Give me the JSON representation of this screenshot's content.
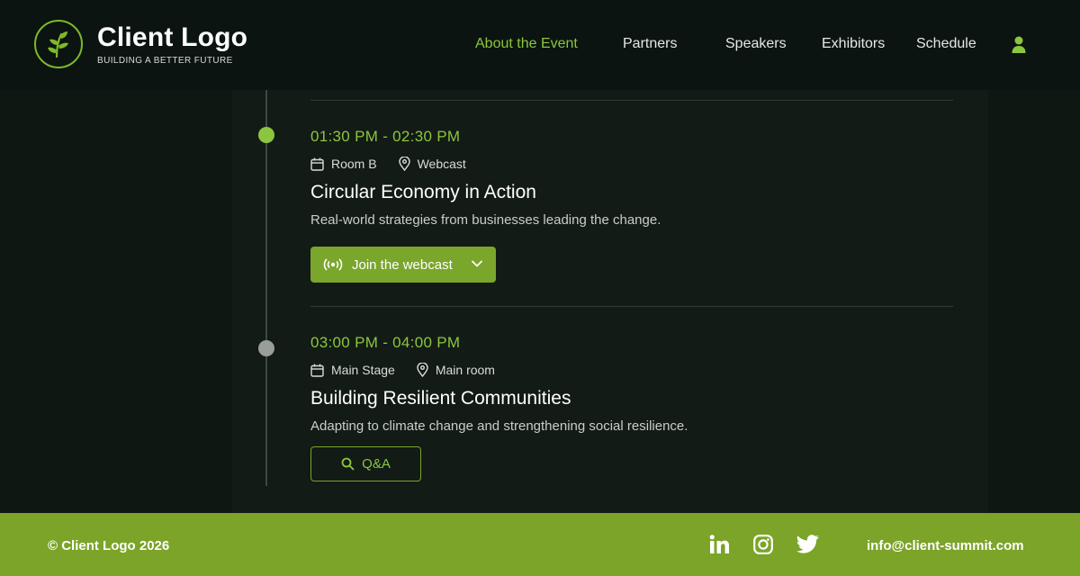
{
  "brand": {
    "title": "Client Logo",
    "tagline": "BUILDING A BETTER FUTURE",
    "accent": "#8cc63f"
  },
  "nav": {
    "items": [
      {
        "label": "About the Event",
        "active": true
      },
      {
        "label": "Partners",
        "active": false
      },
      {
        "label": "Speakers",
        "active": false
      },
      {
        "label": "Exhibitors",
        "active": false
      },
      {
        "label": "Schedule",
        "active": false
      }
    ],
    "user_icon": "user-icon"
  },
  "sessions": [
    {
      "time": "01:30 PM - 02:30 PM",
      "room": "Room B",
      "location": "Webcast",
      "title": "Circular Economy in Action",
      "description": "Real-world strategies from businesses leading the change.",
      "status": "active",
      "action": {
        "label": "Join the webcast",
        "icon": "broadcast-icon",
        "style": "filled"
      }
    },
    {
      "time": "03:00 PM - 04:00 PM",
      "room": "Main Stage",
      "location": "Main room",
      "title": "Building Resilient Communities",
      "description": "Adapting to climate change and strengthening social resilience.",
      "status": "upcoming",
      "action": {
        "label": "Q&A",
        "icon": "search-icon",
        "style": "outlined"
      }
    }
  ],
  "footer": {
    "copyright": "© Client Logo 2026",
    "social": [
      "linkedin-icon",
      "instagram-icon",
      "twitter-icon"
    ],
    "email": "info@client-summit.com"
  }
}
